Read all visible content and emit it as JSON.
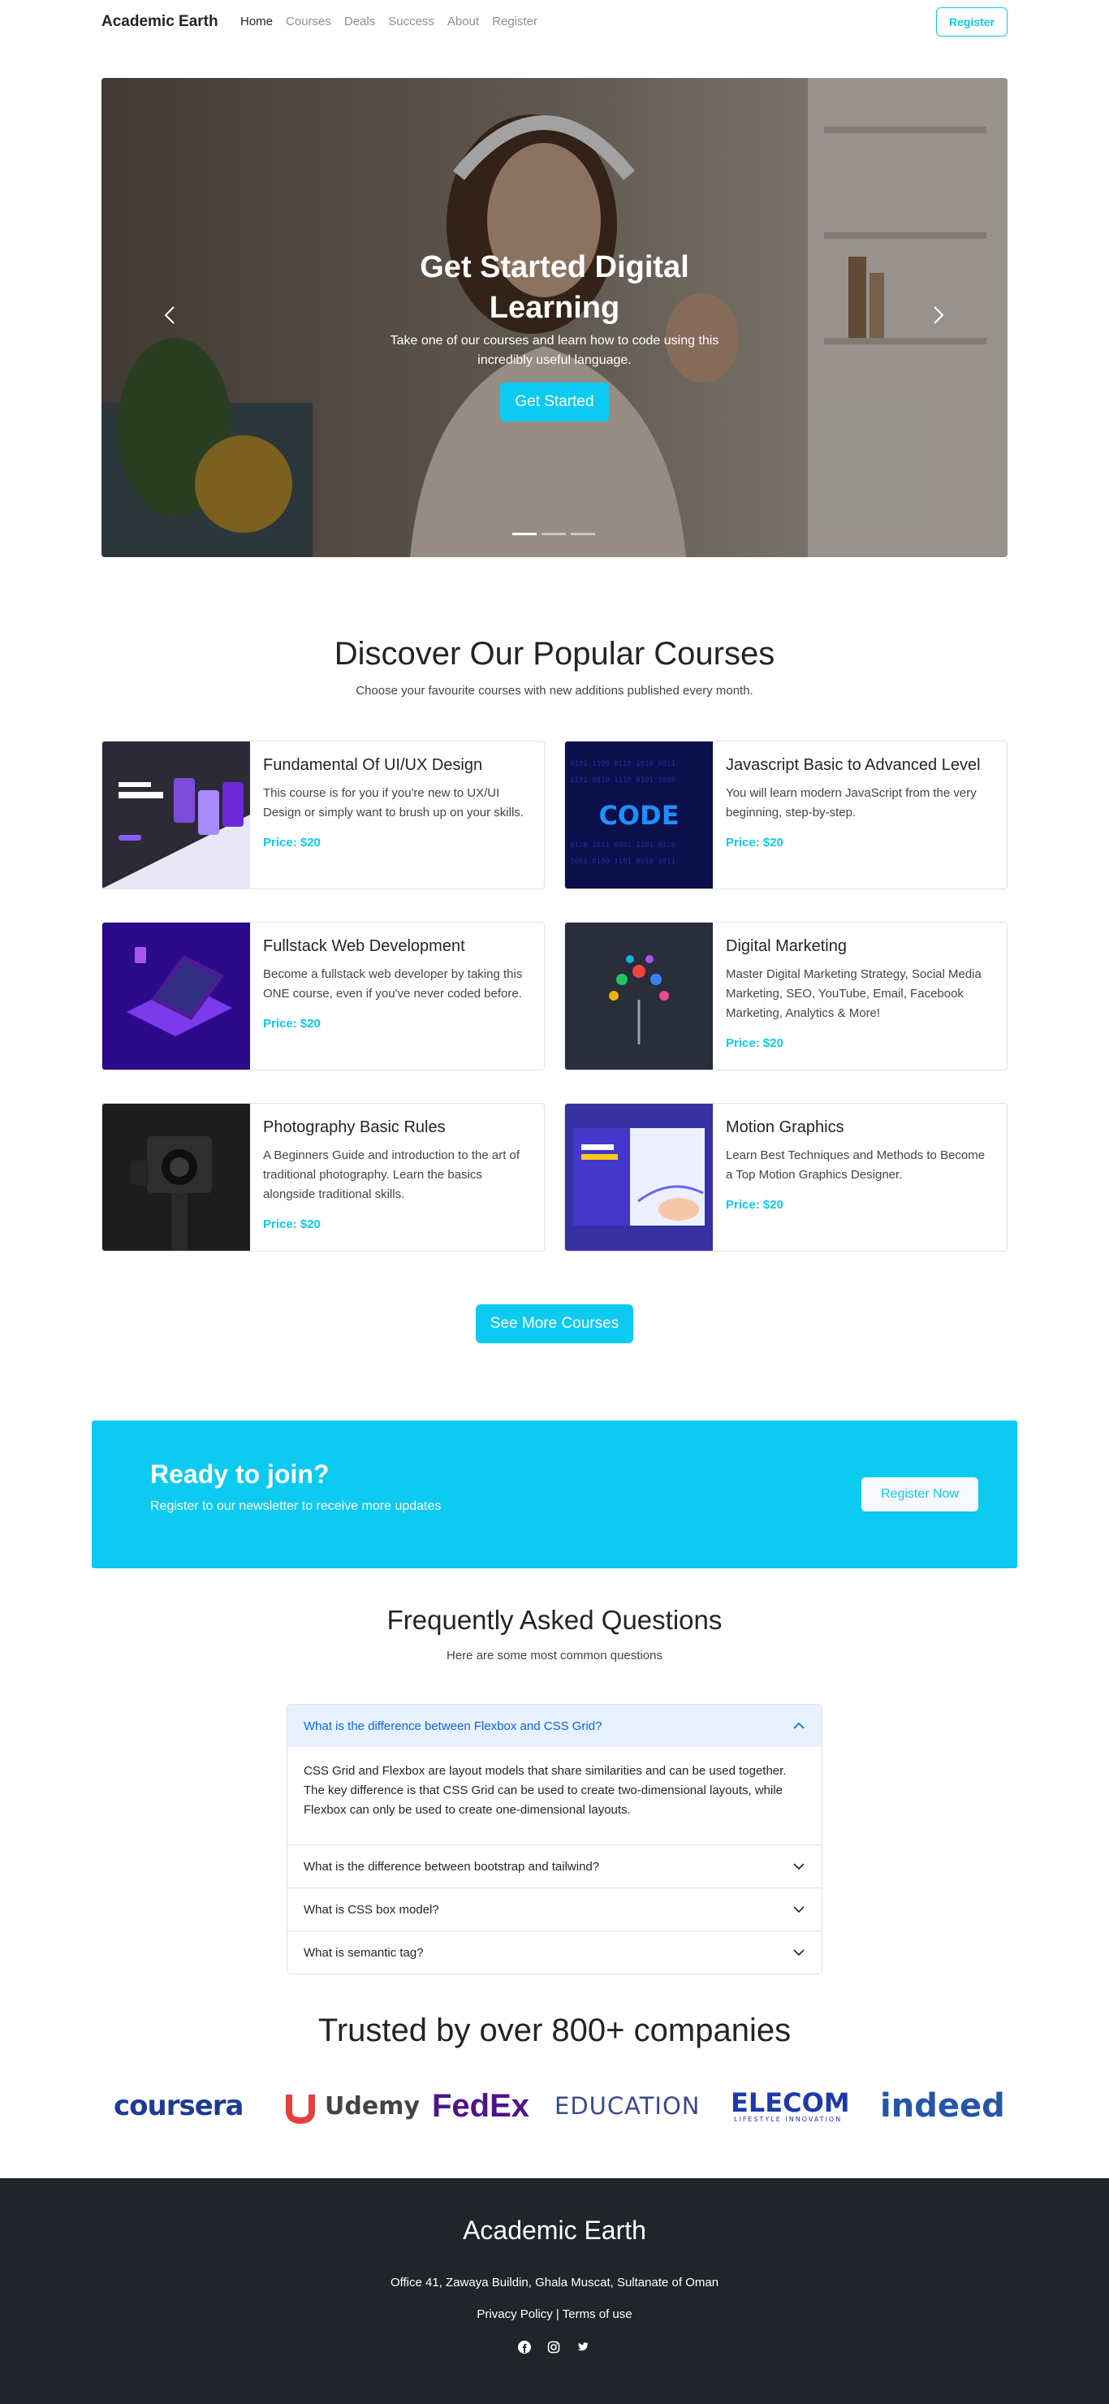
{
  "nav": {
    "brand": "Academic Earth",
    "links": [
      "Home",
      "Courses",
      "Deals",
      "Success",
      "About",
      "Register"
    ],
    "register_button": "Register"
  },
  "hero": {
    "title": "Get Started Digital Learning",
    "subtitle": "Take one of our courses and learn how to code using this incredibly useful language.",
    "button": "Get Started",
    "slide_count": 3,
    "active_slide": 1
  },
  "courses": {
    "title": "Discover Our Popular Courses",
    "subtitle": "Choose your favourite courses with new additions published every month.",
    "items": [
      {
        "title": "Fundamental Of UI/UX Design",
        "description": "This course is for you if you're new to UX/UI Design or simply want to brush up on your skills.",
        "price": "Price: $20",
        "image": "ui-ux-landing-page"
      },
      {
        "title": "Javascript Basic to Advanced Level",
        "description": "You will learn modern JavaScript from the very beginning, step-by-step.",
        "price": "Price: $20",
        "image": "code-binary"
      },
      {
        "title": "Fullstack Web Development",
        "description": "Become a fullstack web developer by taking this ONE course, even if you've never coded before.",
        "price": "Price: $20",
        "image": "isometric-laptop"
      },
      {
        "title": "Digital Marketing",
        "description": "Master Digital Marketing Strategy, Social Media Marketing, SEO, YouTube, Email, Facebook Marketing, Analytics & More!",
        "price": "Price: $20",
        "image": "marketing-tree"
      },
      {
        "title": "Photography Basic Rules",
        "description": "A Beginners Guide and introduction to the art of traditional photography. Learn the basics alongside traditional skills.",
        "price": "Price: $20",
        "image": "camera"
      },
      {
        "title": "Motion Graphics",
        "description": "Learn Best Techniques and Methods to Become a Top Motion Graphics Designer.",
        "price": "Price: $20",
        "image": "motion-graphics"
      }
    ],
    "more_button": "See More Courses"
  },
  "cta": {
    "title": "Ready to join?",
    "subtitle": "Register to our newsletter to receive more updates",
    "button": "Register Now"
  },
  "faq": {
    "title": "Frequently Asked Questions",
    "subtitle": "Here are some most common questions",
    "items": [
      {
        "question": "What is the difference between Flexbox and CSS Grid?",
        "answer": "CSS Grid and Flexbox are layout models that share similarities and can be used together. The key difference is that CSS Grid can be used to create two-dimensional layouts, while Flexbox can only be used to create one-dimensional layouts.",
        "open": true
      },
      {
        "question": "What is the difference between bootstrap and tailwind?",
        "open": false
      },
      {
        "question": "What is CSS box model?",
        "open": false
      },
      {
        "question": "What is semantic tag?",
        "open": false
      }
    ]
  },
  "trusted": {
    "title": "Trusted by over 800+ companies",
    "logos": [
      "coursera",
      "Udemy",
      "FedEx",
      "EDUCATION",
      "ELECOM",
      "indeed"
    ],
    "elecom_tagline": "LIFESTYLE INNOVATION"
  },
  "footer": {
    "brand": "Academic Earth",
    "address": "Office 41, Zawaya Buildin, Ghala Muscat, Sultanate of Oman",
    "privacy": "Privacy Policy",
    "separator": "|",
    "terms": "Terms of use",
    "icons": [
      "facebook-icon",
      "instagram-icon",
      "twitter-icon"
    ]
  },
  "colors": {
    "accent": "#0dcaf0",
    "dark": "#212529",
    "faq_open_bg": "#e7f1ff",
    "faq_open_text": "#0c63e4"
  }
}
